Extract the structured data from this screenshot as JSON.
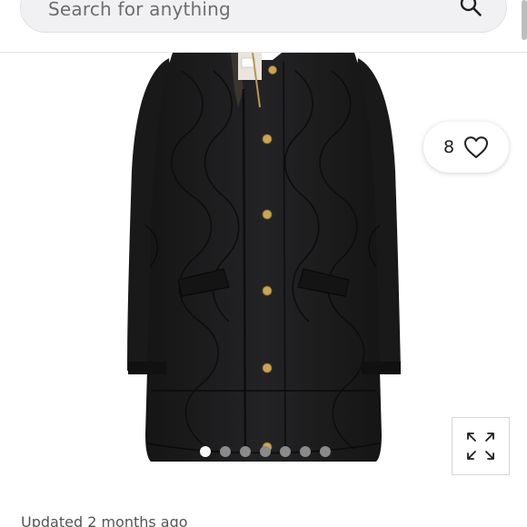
{
  "search": {
    "placeholder": "Search for anything",
    "icon": "search-icon"
  },
  "listing": {
    "like_count": "8",
    "like_icon": "heart-outline-icon",
    "expand_icon": "expand-arrows-icon",
    "image_subject": "black quilted coat",
    "carousel": {
      "total": 7,
      "active_index": 0
    },
    "updated": "Updated 2 months ago"
  },
  "colors": {
    "coat": "#1b1b1c",
    "snap": "#c9a45a",
    "active_dot": "#ffffff",
    "inactive_dot": "#8a8a8a",
    "search_bg": "#f1f1f3"
  }
}
